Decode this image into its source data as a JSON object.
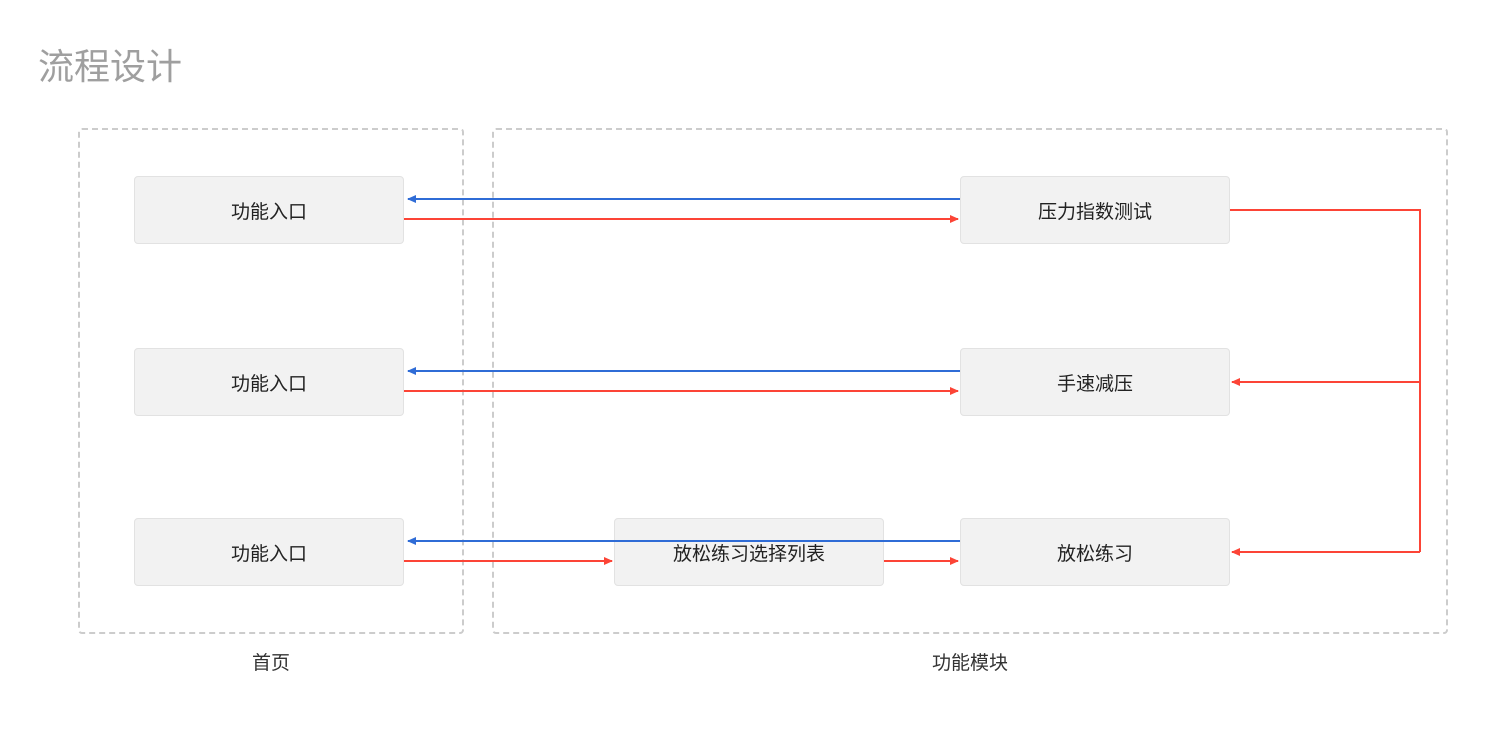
{
  "title": "流程设计",
  "groups": {
    "home": {
      "label": "首页"
    },
    "modules": {
      "label": "功能模块"
    }
  },
  "nodes": {
    "entry1": "功能入口",
    "entry2": "功能入口",
    "entry3": "功能入口",
    "stressTest": "压力指数测试",
    "handSpeed": "手速减压",
    "relaxList": "放松练习选择列表",
    "relax": "放松练习"
  },
  "colors": {
    "red": "#fc4436",
    "blue": "#2f6cd6"
  }
}
